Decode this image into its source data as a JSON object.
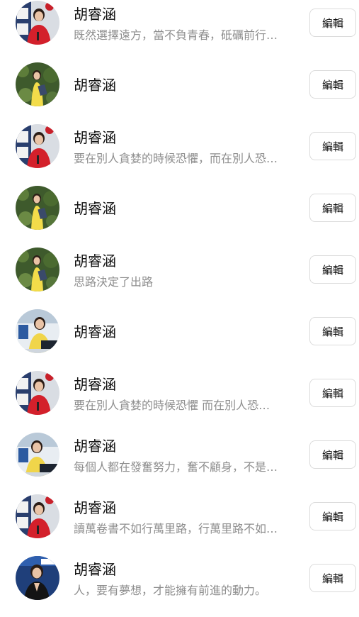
{
  "rows": [
    {
      "name": "胡睿涵",
      "bio": "既然選擇遠方，當不負青春，砥礪前行…",
      "edit": "編輯",
      "avatar": "red-studio-avatar"
    },
    {
      "name": "胡睿涵",
      "bio": "",
      "edit": "編輯",
      "avatar": "yellow-garden-avatar"
    },
    {
      "name": "胡睿涵",
      "bio": "要在別人貪婪的時候恐懼，而在別人恐…",
      "edit": "編輯",
      "avatar": "red-studio-avatar"
    },
    {
      "name": "胡睿涵",
      "bio": "",
      "edit": "編輯",
      "avatar": "yellow-garden-avatar"
    },
    {
      "name": "胡睿涵",
      "bio": "思路決定了出路",
      "edit": "編輯",
      "avatar": "yellow-garden-avatar"
    },
    {
      "name": "胡睿涵",
      "bio": "",
      "edit": "編輯",
      "avatar": "yellow-desk-avatar"
    },
    {
      "name": "胡睿涵",
      "bio": "要在別人貪婪的時候恐懼 而在別人恐…",
      "edit": "編輯",
      "avatar": "red-studio-avatar"
    },
    {
      "name": "胡睿涵",
      "bio": "每個人都在發奮努力，奮不顧身，不是…",
      "edit": "編輯",
      "avatar": "yellow-desk-avatar"
    },
    {
      "name": "胡睿涵",
      "bio": "讀萬卷書不如行萬里路，行萬里路不如…",
      "edit": "編輯",
      "avatar": "red-studio-avatar"
    },
    {
      "name": "胡睿涵",
      "bio": "人，要有夢想，才能擁有前進的動力。",
      "edit": "編輯",
      "avatar": "black-news-avatar"
    }
  ]
}
